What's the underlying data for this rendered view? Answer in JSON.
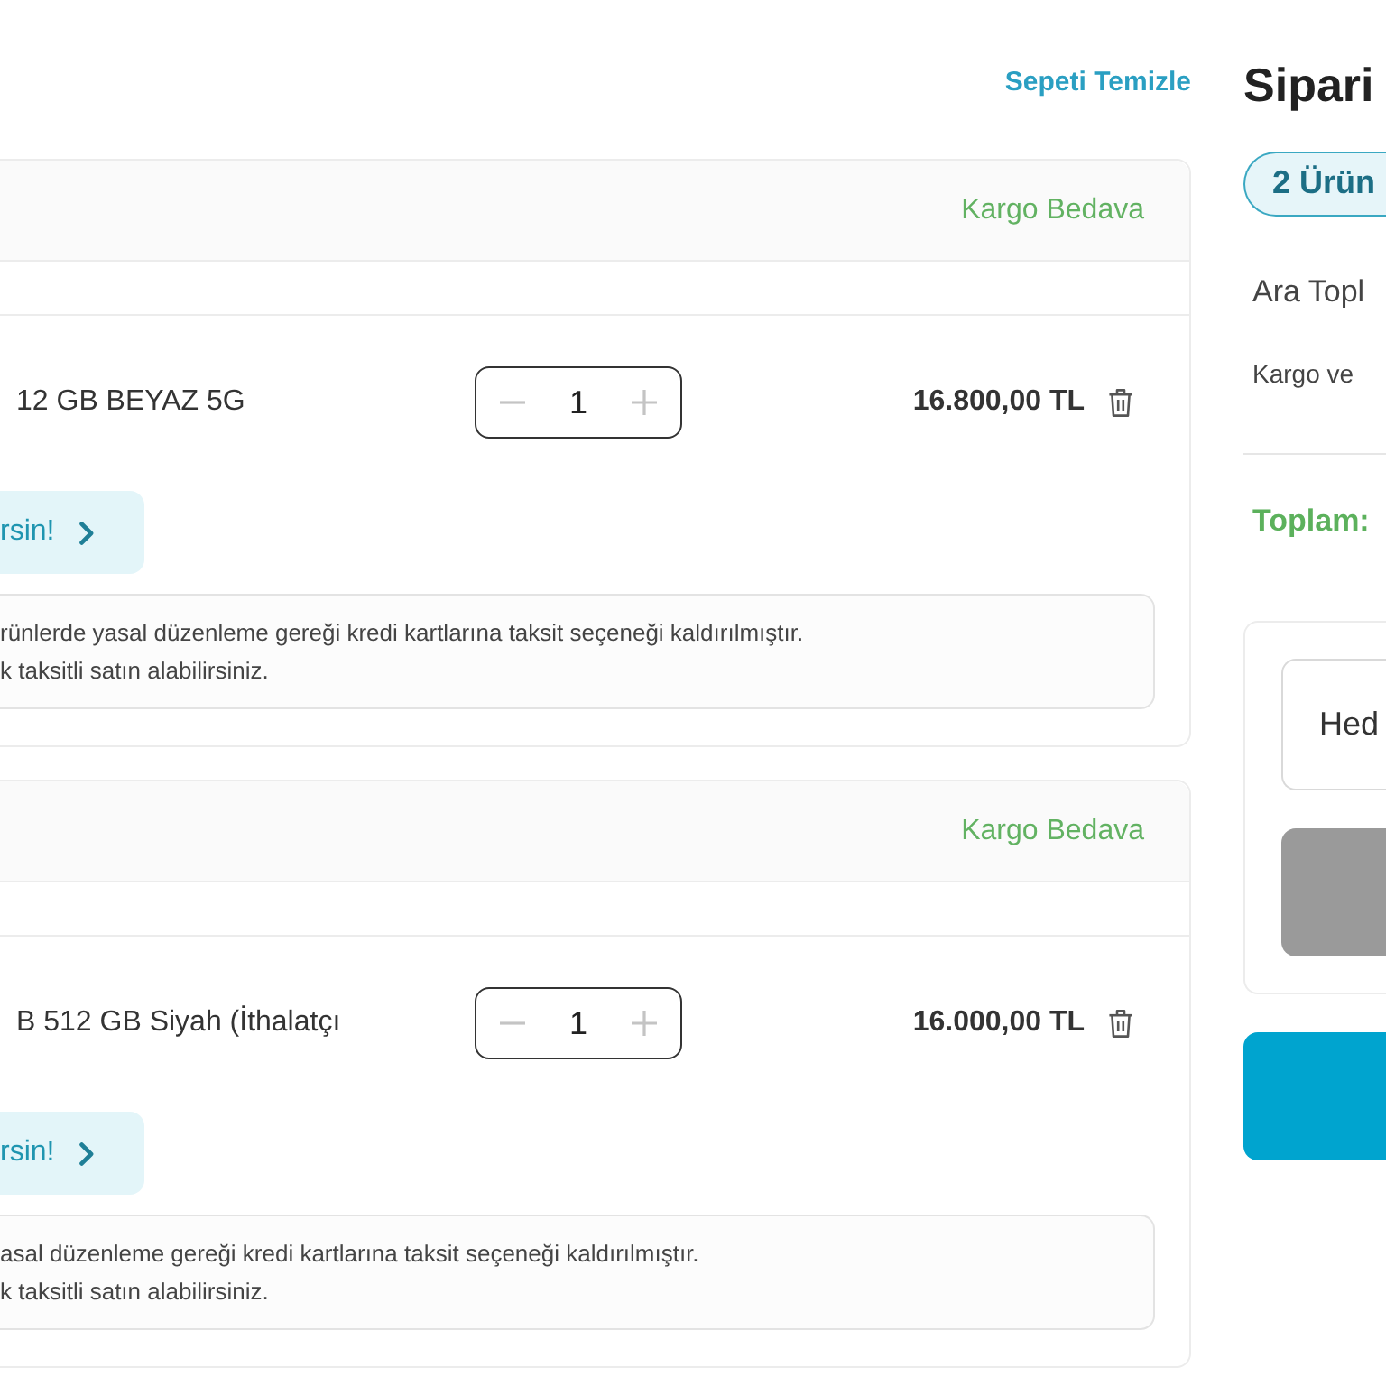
{
  "header": {
    "clear_cart_link": "Sepeti Temizle"
  },
  "cart_groups": [
    {
      "shipping_note": "Kargo Bedava",
      "product": {
        "title": "12 GB BEYAZ 5G",
        "quantity": "1",
        "price": "16.800,00 TL"
      },
      "campaign_button": "rsin!",
      "notice_lines": [
        "rünlerde yasal düzenleme gereği kredi kartlarına taksit seçeneği kaldırılmıştır.",
        "k taksitli satın alabilirsiniz."
      ]
    },
    {
      "shipping_note": "Kargo Bedava",
      "product": {
        "title": "B 512 GB Siyah (İthalatçı",
        "quantity": "1",
        "price": "16.000,00 TL"
      },
      "campaign_button": "rsin!",
      "notice_lines": [
        "asal düzenleme gereği kredi kartlarına taksit seçeneği kaldırılmıştır.",
        "k taksitli satın alabilirsiniz."
      ]
    }
  ],
  "summary": {
    "title": "Sipari",
    "item_count_badge": "2 Ürün",
    "subtotal_label": "Ara Topl",
    "shipping_label": "Kargo ve",
    "total_label": "Toplam:",
    "gift_code": {
      "placeholder": "Hed"
    },
    "apply_button": {
      "disabled": true
    }
  }
}
